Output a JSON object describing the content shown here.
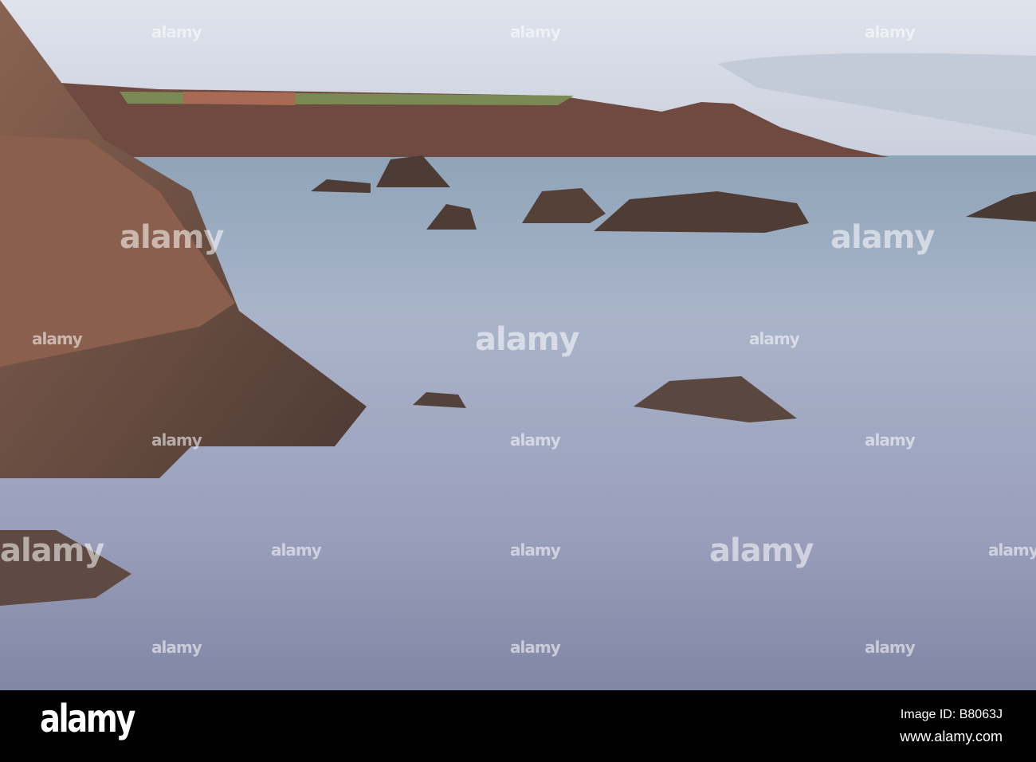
{
  "watermark": {
    "text": "alamy"
  },
  "footer": {
    "logo": "alamy",
    "image_id": "Image ID: B8063J",
    "url": "www.alamy.com"
  }
}
